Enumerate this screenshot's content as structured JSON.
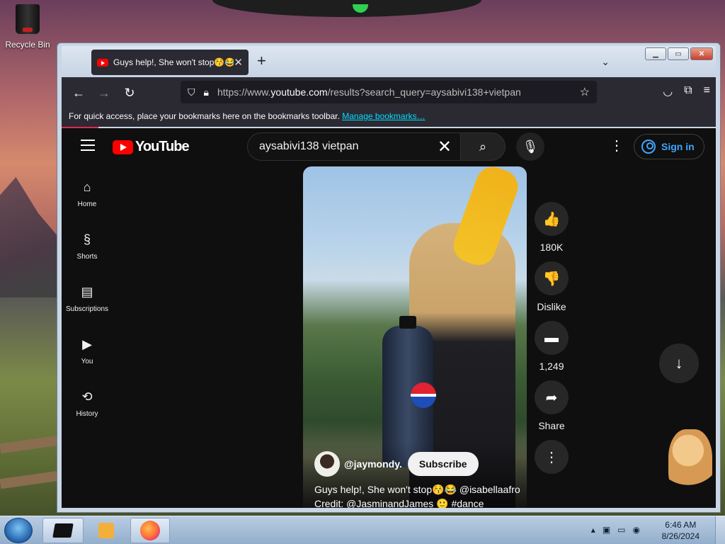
{
  "desktop": {
    "icons": [
      {
        "label": "Recycle Bin",
        "icon": "recycle-bin-icon"
      }
    ]
  },
  "browser": {
    "tab": {
      "title": "Guys help!, She won't stop😚😂",
      "close": "✕"
    },
    "new_tab": "+",
    "tab_list": "⌄",
    "window_controls": {
      "minimize": "▁",
      "maximize": "▭",
      "close": "✕"
    },
    "url": {
      "prefix": "https://www.",
      "domain": "youtube.com",
      "path": "/results?search_query=aysabivi138+vietpan"
    },
    "bookmarks_bar": {
      "text": "For quick access, place your bookmarks here on the bookmarks toolbar.",
      "link": "Manage bookmarks…"
    }
  },
  "youtube": {
    "logo_text": "YouTube",
    "search": {
      "value": "aysabivi138 vietpan"
    },
    "sign_in": "Sign in",
    "guide": [
      {
        "icon": "home-icon",
        "glyph": "⌂",
        "label": "Home"
      },
      {
        "icon": "shorts-icon",
        "glyph": "§",
        "label": "Shorts"
      },
      {
        "icon": "subscriptions-icon",
        "glyph": "▤",
        "label": "Subscriptions"
      },
      {
        "icon": "you-icon",
        "glyph": "▶",
        "label": "You"
      },
      {
        "icon": "history-icon",
        "glyph": "⟲",
        "label": "History"
      }
    ],
    "short": {
      "channel_handle": "@jaymondy.",
      "subscribe": "Subscribe",
      "title_line1": "Guys help!, She won't stop😚😂 @isabellaafro",
      "title_line2": "Credit: @JasminandJames 🙂 #dance"
    },
    "actions": [
      {
        "icon": "like-icon",
        "glyph": "👍",
        "label": "180K"
      },
      {
        "icon": "dislike-icon",
        "glyph": "👎",
        "label": "Dislike"
      },
      {
        "icon": "comment-icon",
        "glyph": "▬",
        "label": "1,249"
      },
      {
        "icon": "share-icon",
        "glyph": "➦",
        "label": "Share"
      },
      {
        "icon": "more-icon",
        "glyph": "⋮",
        "label": ""
      }
    ]
  },
  "taskbar": {
    "clock": {
      "time": "6:46 AM",
      "date": "8/26/2024"
    }
  },
  "colors": {
    "youtube_red": "#ff0000",
    "link_cyan": "#00ddff",
    "signin_blue": "#3ea6ff",
    "bg": "#0f0f0f"
  }
}
